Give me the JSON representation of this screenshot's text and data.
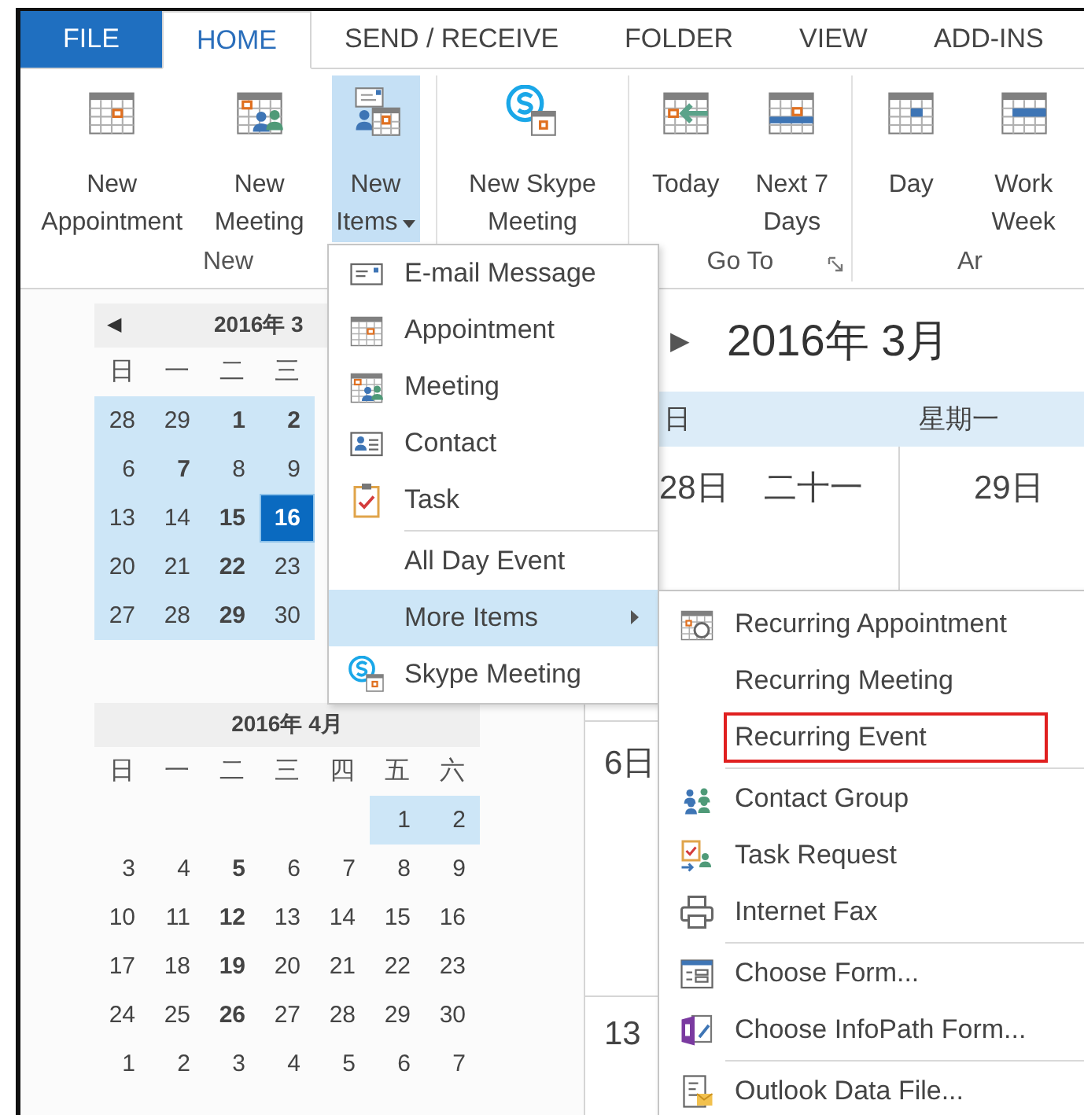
{
  "tabs": [
    {
      "label": "FILE",
      "kind": "file",
      "selected": false
    },
    {
      "label": "HOME",
      "kind": "tab",
      "selected": true
    },
    {
      "label": "SEND / RECEIVE",
      "kind": "tab",
      "selected": false
    },
    {
      "label": "FOLDER",
      "kind": "tab",
      "selected": false
    },
    {
      "label": "VIEW",
      "kind": "tab",
      "selected": false
    },
    {
      "label": "ADD-INS",
      "kind": "tab",
      "selected": false
    }
  ],
  "ribbon": {
    "groups": [
      {
        "label": "New",
        "launcher": false,
        "buttons": [
          {
            "lines": [
              "New",
              "Appointment"
            ],
            "pressed": false,
            "dropdown": false
          },
          {
            "lines": [
              "New",
              "Meeting"
            ],
            "pressed": false,
            "dropdown": false
          },
          {
            "lines": [
              "New",
              "Items"
            ],
            "pressed": true,
            "dropdown": true
          }
        ]
      },
      {
        "buttons": [
          {
            "lines": [
              "New Skype",
              "Meeting"
            ],
            "pressed": false,
            "dropdown": false
          }
        ]
      },
      {
        "label": "Go To",
        "launcher": true,
        "buttons": [
          {
            "lines": [
              "Today"
            ],
            "pressed": false,
            "dropdown": false
          },
          {
            "lines": [
              "Next 7",
              "Days"
            ],
            "pressed": false,
            "dropdown": false
          }
        ]
      },
      {
        "label": "Ar",
        "launcher": false,
        "buttons": [
          {
            "lines": [
              "Day"
            ],
            "pressed": false,
            "dropdown": false
          },
          {
            "lines": [
              "Work",
              "Week"
            ],
            "pressed": false,
            "dropdown": false
          }
        ]
      }
    ]
  },
  "mini_calendars": [
    {
      "prev_arrow": "◀",
      "title": "2016年 3",
      "first_week_starts_late": false,
      "weekdays": [
        "日",
        "一",
        "二",
        "三"
      ],
      "weeks": [
        [
          {
            "d": "28",
            "bold": false,
            "selected": true,
            "today": false
          },
          {
            "d": "29",
            "bold": false,
            "selected": true,
            "today": false
          },
          {
            "d": "1",
            "bold": true,
            "selected": true,
            "today": false
          },
          {
            "d": "2",
            "bold": true,
            "selected": true,
            "today": false
          }
        ],
        [
          {
            "d": "6",
            "bold": false,
            "selected": true,
            "today": false
          },
          {
            "d": "7",
            "bold": true,
            "selected": true,
            "today": false
          },
          {
            "d": "8",
            "bold": false,
            "selected": true,
            "today": false
          },
          {
            "d": "9",
            "bold": false,
            "selected": true,
            "today": false
          }
        ],
        [
          {
            "d": "13",
            "bold": false,
            "selected": true,
            "today": false
          },
          {
            "d": "14",
            "bold": false,
            "selected": true,
            "today": false
          },
          {
            "d": "15",
            "bold": true,
            "selected": true,
            "today": false
          },
          {
            "d": "16",
            "bold": true,
            "selected": true,
            "today": true
          }
        ],
        [
          {
            "d": "20",
            "bold": false,
            "selected": true,
            "today": false
          },
          {
            "d": "21",
            "bold": false,
            "selected": true,
            "today": false
          },
          {
            "d": "22",
            "bold": true,
            "selected": true,
            "today": false
          },
          {
            "d": "23",
            "bold": false,
            "selected": true,
            "today": false
          }
        ],
        [
          {
            "d": "27",
            "bold": false,
            "selected": true,
            "today": false
          },
          {
            "d": "28",
            "bold": false,
            "selected": true,
            "today": false
          },
          {
            "d": "29",
            "bold": true,
            "selected": true,
            "today": false
          },
          {
            "d": "30",
            "bold": false,
            "selected": true,
            "today": false
          }
        ]
      ]
    },
    {
      "title": "2016年 4月",
      "first_week_starts_late": true,
      "weekdays": [
        "日",
        "一",
        "二",
        "三",
        "四",
        "五",
        "六"
      ],
      "weeks": [
        [
          {
            "d": "1",
            "bold": false,
            "selected": true,
            "today": false
          },
          {
            "d": "2",
            "bold": false,
            "selected": true,
            "today": false
          }
        ],
        [
          {
            "d": "3",
            "bold": false,
            "selected": false,
            "today": false
          },
          {
            "d": "4",
            "bold": false,
            "selected": false,
            "today": false
          },
          {
            "d": "5",
            "bold": true,
            "selected": false,
            "today": false
          },
          {
            "d": "6",
            "bold": false,
            "selected": false,
            "today": false
          },
          {
            "d": "7",
            "bold": false,
            "selected": false,
            "today": false
          },
          {
            "d": "8",
            "bold": false,
            "selected": false,
            "today": false
          },
          {
            "d": "9",
            "bold": false,
            "selected": false,
            "today": false
          }
        ],
        [
          {
            "d": "10",
            "bold": false,
            "selected": false,
            "today": false
          },
          {
            "d": "11",
            "bold": false,
            "selected": false,
            "today": false
          },
          {
            "d": "12",
            "bold": true,
            "selected": false,
            "today": false
          },
          {
            "d": "13",
            "bold": false,
            "selected": false,
            "today": false
          },
          {
            "d": "14",
            "bold": false,
            "selected": false,
            "today": false
          },
          {
            "d": "15",
            "bold": false,
            "selected": false,
            "today": false
          },
          {
            "d": "16",
            "bold": false,
            "selected": false,
            "today": false
          }
        ],
        [
          {
            "d": "17",
            "bold": false,
            "selected": false,
            "today": false
          },
          {
            "d": "18",
            "bold": false,
            "selected": false,
            "today": false
          },
          {
            "d": "19",
            "bold": true,
            "selected": false,
            "today": false
          },
          {
            "d": "20",
            "bold": false,
            "selected": false,
            "today": false
          },
          {
            "d": "21",
            "bold": false,
            "selected": false,
            "today": false
          },
          {
            "d": "22",
            "bold": false,
            "selected": false,
            "today": false
          },
          {
            "d": "23",
            "bold": false,
            "selected": false,
            "today": false
          }
        ],
        [
          {
            "d": "24",
            "bold": false,
            "selected": false,
            "today": false
          },
          {
            "d": "25",
            "bold": false,
            "selected": false,
            "today": false
          },
          {
            "d": "26",
            "bold": true,
            "selected": false,
            "today": false
          },
          {
            "d": "27",
            "bold": false,
            "selected": false,
            "today": false
          },
          {
            "d": "28",
            "bold": false,
            "selected": false,
            "today": false
          },
          {
            "d": "29",
            "bold": false,
            "selected": false,
            "today": false
          },
          {
            "d": "30",
            "bold": false,
            "selected": false,
            "today": false
          }
        ],
        [
          {
            "d": "1",
            "bold": false,
            "selected": false,
            "today": false
          },
          {
            "d": "2",
            "bold": false,
            "selected": false,
            "today": false
          },
          {
            "d": "3",
            "bold": false,
            "selected": false,
            "today": false
          },
          {
            "d": "4",
            "bold": false,
            "selected": false,
            "today": false
          },
          {
            "d": "5",
            "bold": false,
            "selected": false,
            "today": false
          },
          {
            "d": "6",
            "bold": false,
            "selected": false,
            "today": false
          },
          {
            "d": "7",
            "bold": false,
            "selected": false,
            "today": false
          }
        ]
      ]
    }
  ],
  "calendar": {
    "next_arrow": "▶",
    "title": "2016年 3月",
    "day_headers": [
      "日",
      "星期一"
    ],
    "weeks": [
      {
        "cells": [
          {
            "date": "28日",
            "lunar": "二十一"
          },
          {
            "date": "29日"
          }
        ]
      },
      {
        "cells": [
          {
            "date": "6日"
          }
        ]
      },
      {
        "cells": [
          {
            "date": "13"
          }
        ]
      }
    ]
  },
  "new_items_menu": {
    "items": [
      {
        "label": "E-mail Message",
        "separator_before": false,
        "selected": false,
        "submenu": false
      },
      {
        "label": "Appointment",
        "separator_before": false,
        "selected": false,
        "submenu": false
      },
      {
        "label": "Meeting",
        "separator_before": false,
        "selected": false,
        "submenu": false
      },
      {
        "label": "Contact",
        "separator_before": false,
        "selected": false,
        "submenu": false
      },
      {
        "label": "Task",
        "separator_before": false,
        "selected": false,
        "submenu": false
      },
      {
        "label": "All Day Event",
        "separator_before": true,
        "selected": false,
        "submenu": false
      },
      {
        "label": "More Items",
        "separator_before": false,
        "selected": true,
        "submenu": true
      },
      {
        "label": "Skype Meeting",
        "separator_before": false,
        "selected": false,
        "submenu": false
      }
    ]
  },
  "more_items_menu": {
    "items": [
      {
        "label": "Recurring Appointment",
        "separator_before": false,
        "boxed": false
      },
      {
        "label": "Recurring Meeting",
        "separator_before": false,
        "boxed": false
      },
      {
        "label": "Recurring Event",
        "separator_before": false,
        "boxed": true
      },
      {
        "label": "Contact Group",
        "separator_before": true,
        "boxed": false
      },
      {
        "label": "Task Request",
        "separator_before": false,
        "boxed": false
      },
      {
        "label": "Internet Fax",
        "separator_before": false,
        "boxed": false
      },
      {
        "label": "Choose Form...",
        "separator_before": true,
        "boxed": false
      },
      {
        "label": "Choose InfoPath Form...",
        "separator_before": false,
        "boxed": false
      },
      {
        "label": "Outlook Data File...",
        "separator_before": true,
        "boxed": false
      }
    ]
  }
}
